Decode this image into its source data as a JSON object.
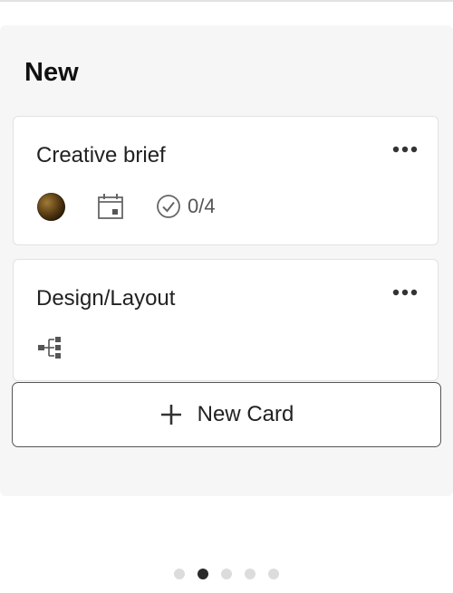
{
  "column": {
    "title": "New",
    "cards": [
      {
        "title": "Creative brief",
        "more_icon": "more-horizontal-icon",
        "avatar_icon": "member-avatar",
        "date_icon": "calendar-icon",
        "checklist_icon": "check-circle-icon",
        "checklist_count": "0/4"
      },
      {
        "title": "Design/Layout",
        "more_icon": "more-horizontal-icon",
        "subtask_icon": "subtasks-icon"
      }
    ],
    "add_button": {
      "label": "New Card",
      "icon": "plus-icon"
    }
  },
  "pager": {
    "count": 5,
    "active_index": 1
  },
  "colors": {
    "column_bg": "#f6f6f6",
    "card_border": "#e2e2e2",
    "active_dot": "#2a2a2a",
    "inactive_dot": "#dcdcdc"
  }
}
